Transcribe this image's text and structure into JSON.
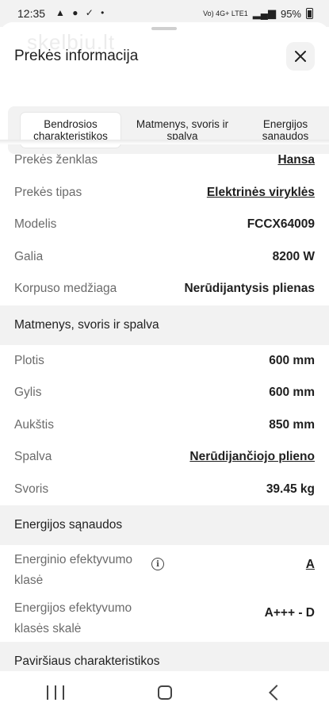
{
  "status_bar": {
    "time": "12:35",
    "notification_glyphs": "▲ ● ✓ •",
    "network_label": "Vo) 4G+ LTE1",
    "battery": "95%"
  },
  "watermark": "skelbiu.lt",
  "sheet": {
    "title": "Prekės informacija",
    "tabs": [
      {
        "label": "Bendrosios charakteristikos",
        "active": true
      },
      {
        "label": "Matmenys, svoris ir spalva",
        "active": false
      },
      {
        "label": "Energijos sąnaudos",
        "active": false
      }
    ]
  },
  "general": [
    {
      "label": "Prekės ženklas",
      "value": "Hansa"
    },
    {
      "label": "Prekės tipas",
      "value": "Elektrinės viryklės"
    },
    {
      "label": "Modelis",
      "value": "FCCX64009"
    },
    {
      "label": "Galia",
      "value": "8200 W"
    },
    {
      "label": "Korpuso medžiaga",
      "value": "Nerūdijantysis plienas"
    }
  ],
  "dimensions": {
    "heading": "Matmenys, svoris ir spalva",
    "rows": [
      {
        "label": "Plotis",
        "value": "600 mm"
      },
      {
        "label": "Gylis",
        "value": "600 mm"
      },
      {
        "label": "Aukštis",
        "value": "850 mm"
      },
      {
        "label": "Spalva",
        "value": "Nerūdijančiojo plieno"
      },
      {
        "label": "Svoris",
        "value": "39.45 kg"
      }
    ]
  },
  "energy": {
    "heading": "Energijos sąnaudos",
    "rows": [
      {
        "label": "Energinio efektyvumo klasė",
        "value": "A"
      },
      {
        "label": "Energijos efektyvumo klasės skalė",
        "value": "A+++ - D"
      }
    ]
  },
  "surface": {
    "heading": "Paviršiaus charakteristikos"
  }
}
